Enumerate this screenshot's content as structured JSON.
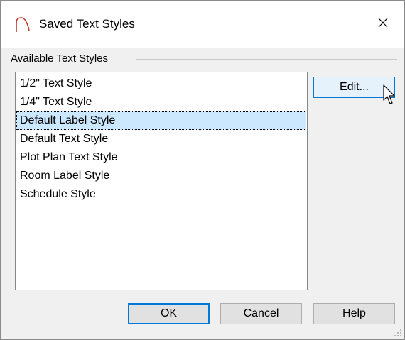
{
  "window": {
    "title": "Saved Text Styles",
    "icon": "arch-icon",
    "accent_color": "#c0392b"
  },
  "group": {
    "label": "Available Text Styles"
  },
  "list": {
    "selected_index": 2,
    "items": [
      "1/2\" Text Style",
      "1/4\" Text Style",
      "Default Label Style",
      "Default Text Style",
      "Plot Plan Text Style",
      "Room Label Style",
      "Schedule Style"
    ]
  },
  "buttons": {
    "edit": "Edit...",
    "ok": "OK",
    "cancel": "Cancel",
    "help": "Help"
  },
  "colors": {
    "selection": "#cce8ff",
    "focus_border": "#0078d7",
    "button_face": "#e1e1e1"
  }
}
